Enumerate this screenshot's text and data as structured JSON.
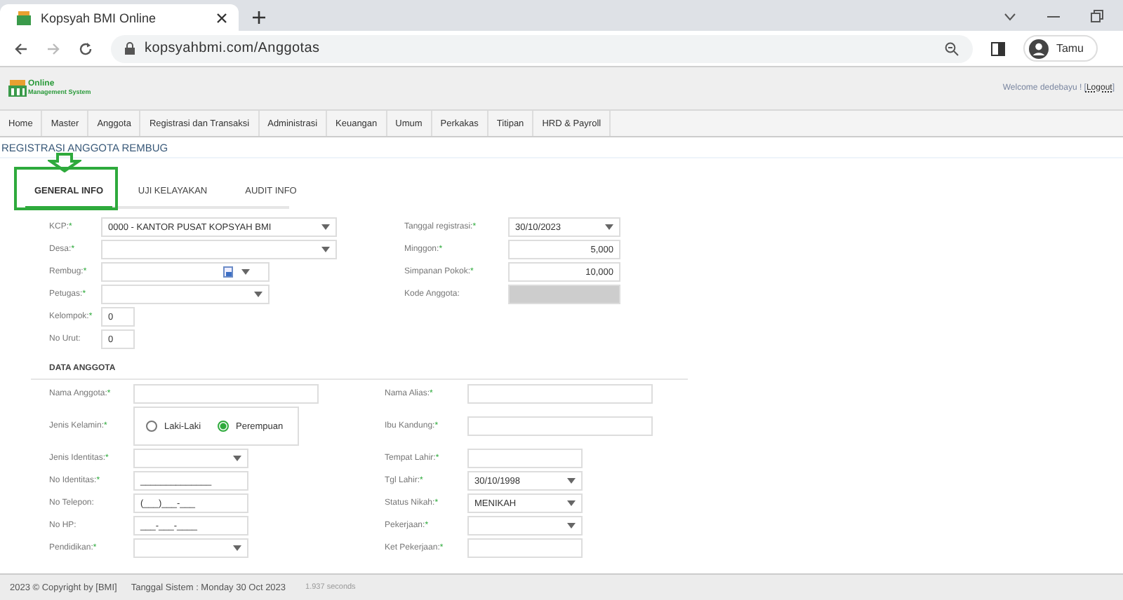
{
  "browser": {
    "tab_title": "Kopsyah BMI Online",
    "url": "kopsyahbmi.com/Anggotas",
    "profile": "Tamu"
  },
  "header": {
    "logo_line1": "Online",
    "logo_line2": "Management System",
    "welcome": "Welcome dedebayu ! [",
    "logout": "Logout",
    "welcome_end": "]"
  },
  "menu": [
    "Home",
    "Master",
    "Anggota",
    "Registrasi dan Transaksi",
    "Administrasi",
    "Keuangan",
    "Umum",
    "Perkakas",
    "Titipan",
    "HRD & Payroll"
  ],
  "page_title": "REGISTRASI ANGGOTA REMBUG",
  "tabs": [
    {
      "label": "GENERAL INFO",
      "selected": true,
      "highlighted": true
    },
    {
      "label": "UJI KELAYAKAN",
      "selected": false,
      "highlighted": false
    },
    {
      "label": "AUDIT INFO",
      "selected": false,
      "highlighted": false
    }
  ],
  "general": {
    "left": [
      {
        "label": "KCP:",
        "required": "*",
        "kind": "select",
        "value": "0000 - KANTOR PUSAT KOPSYAH BMI"
      },
      {
        "label": "Desa:",
        "required": "*",
        "kind": "select"
      },
      {
        "label": "Rembug:",
        "required": "*",
        "kind": "lookup"
      },
      {
        "label": "Petugas:",
        "required": "*",
        "kind": "select"
      },
      {
        "label": "Kelompok:",
        "required": "*",
        "kind": "text",
        "value": "0"
      },
      {
        "label": "No Urut:",
        "kind": "text",
        "value": "0"
      }
    ],
    "right": [
      {
        "label": "Tanggal registrasi:",
        "required": "*",
        "kind": "select",
        "value": "30/10/2023"
      },
      {
        "label": "Minggon:",
        "required": "*",
        "kind": "number",
        "value": "5,000"
      },
      {
        "label": "Simpanan Pokok:",
        "required": "*",
        "kind": "number",
        "value": "10,000"
      },
      {
        "label": "Kode Anggota:",
        "kind": "readonly"
      }
    ]
  },
  "data_anggota": {
    "title": "DATA ANGGOTA",
    "left": [
      {
        "label": "Nama Anggota:",
        "required": "*",
        "kind": "text"
      },
      {
        "label": "Jenis Kelamin:",
        "required": "*",
        "kind": "radio",
        "options": [
          {
            "label": "Laki-Laki",
            "selected": false
          },
          {
            "label": "Perempuan",
            "selected": true
          }
        ]
      },
      {
        "label": "Jenis Identitas:",
        "required": "*",
        "kind": "select"
      },
      {
        "label": "No Identitas:",
        "required": "*",
        "kind": "text",
        "value": "______________"
      },
      {
        "label": "No Telepon:",
        "kind": "text",
        "value": "(___)___-___"
      },
      {
        "label": "No HP:",
        "kind": "text",
        "value": "___-___-____"
      },
      {
        "label": "Pendidikan:",
        "required": "*",
        "kind": "select"
      }
    ],
    "right": [
      {
        "label": "Nama Alias:",
        "required": "*",
        "kind": "text"
      },
      {
        "label": "Ibu Kandung:",
        "required": "*",
        "kind": "text"
      },
      {
        "label": "Tempat Lahir:",
        "required": "*",
        "kind": "text"
      },
      {
        "label": "Tgl Lahir:",
        "required": "*",
        "kind": "select",
        "value": "30/10/1998"
      },
      {
        "label": "Status Nikah:",
        "required": "*",
        "kind": "select",
        "value": "MENIKAH"
      },
      {
        "label": "Pekerjaan:",
        "required": "*",
        "kind": "select"
      },
      {
        "label": "Ket Pekerjaan:",
        "required": "*",
        "kind": "text"
      }
    ]
  },
  "footer": {
    "copyright": "2023 © Copyright by [BMI]",
    "system_date": "Tanggal Sistem : Monday 30 Oct 2023",
    "timing": "1.937 seconds"
  }
}
